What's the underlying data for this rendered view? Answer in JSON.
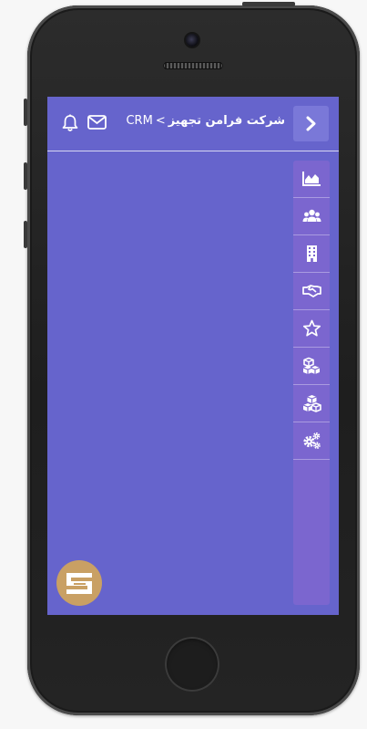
{
  "header": {
    "app_name": "CRM",
    "separator": ">",
    "company": "شرکت فرامن تجهیز"
  },
  "icons": {
    "back": "chevron-right-icon",
    "notifications": "bell-icon",
    "messages": "envelope-icon"
  },
  "sidebar": {
    "items": [
      {
        "icon": "area-chart-icon"
      },
      {
        "icon": "users-icon"
      },
      {
        "icon": "building-icon"
      },
      {
        "icon": "handshake-icon"
      },
      {
        "icon": "star-icon"
      },
      {
        "icon": "cubes-icon"
      },
      {
        "icon": "cubes-alt-icon"
      },
      {
        "icon": "cogs-icon"
      }
    ]
  },
  "colors": {
    "screen_bg": "#6664cc",
    "sidebar_bg": "#7b66cf",
    "back_button_bg": "#7a78d8",
    "logo_bg": "#c9a064"
  }
}
